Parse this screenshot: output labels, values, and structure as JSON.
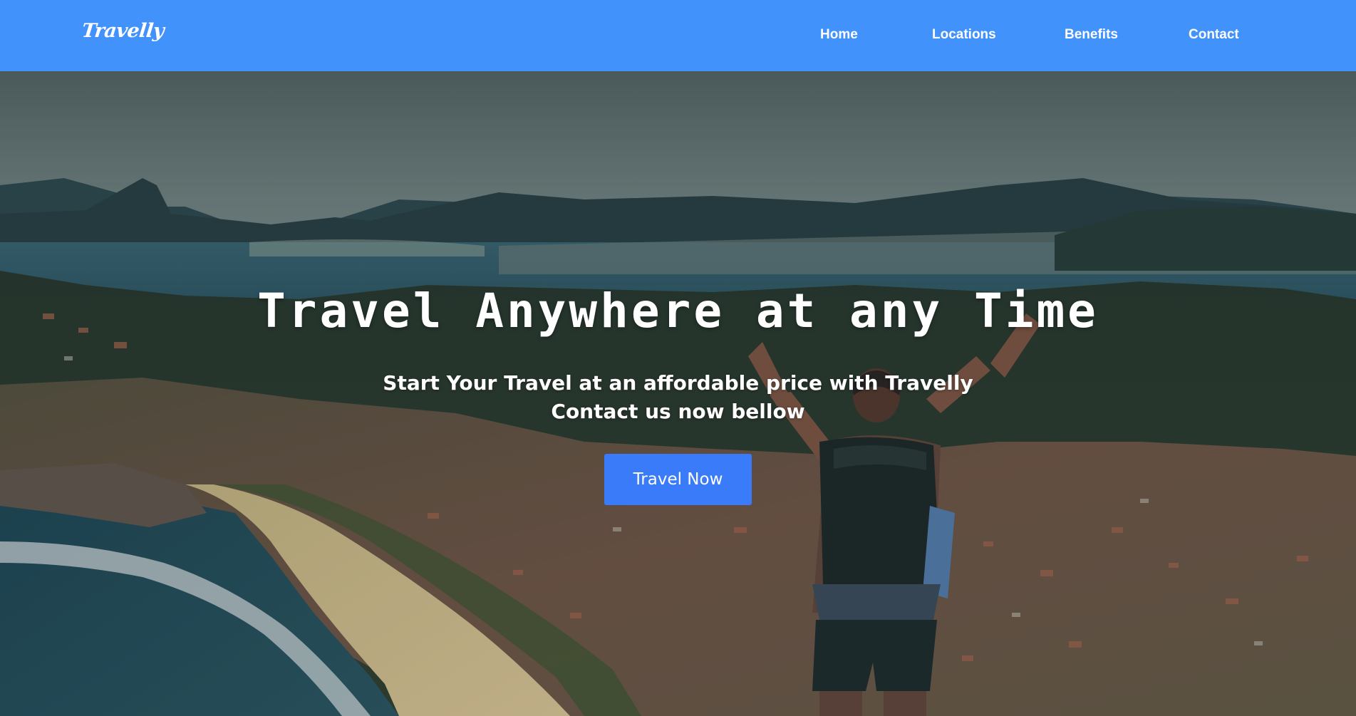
{
  "navbar": {
    "logo": "Travelly",
    "links": [
      "Home",
      "Locations",
      "Benefits",
      "Contact"
    ],
    "background_color": "#4292fc"
  },
  "hero": {
    "title": "Travel Anywhere at any Time",
    "subtitle_line1": "Start Your Travel at an affordable price with Travelly",
    "subtitle_line2": "Contact us now bellow",
    "cta_label": "Travel Now",
    "cta_color": "#3a7bfa"
  }
}
